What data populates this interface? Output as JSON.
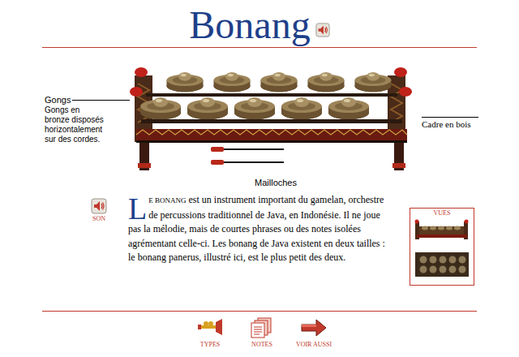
{
  "title": "Bonang",
  "illustration": {
    "gongs_label": {
      "title": "Gongs",
      "description": "Gongs en bronze disposés horizontalement sur des cordes."
    },
    "frame_label": "Cadre en bois",
    "mallets_label": "Mailloches"
  },
  "sound_button": {
    "label": "SON"
  },
  "article": {
    "drop_cap": "L",
    "lead": "E BONANG",
    "body": " est un instrument important du gamelan, orchestre de percussions traditionnel de Java, en Indonésie. Il ne joue pas la mélodie, mais de courtes phrases ou des notes isolées agrémentant celle-ci. Les bonang de Java existent en deux tailles  : le bonang panerus, illustré ici, est le plus petit des deux."
  },
  "views": {
    "title": "VUES"
  },
  "nav": [
    {
      "label": "TYPES",
      "kind": "types"
    },
    {
      "label": "NOTES",
      "kind": "notes"
    },
    {
      "label": "VOIR AUSSI",
      "kind": "see"
    }
  ]
}
